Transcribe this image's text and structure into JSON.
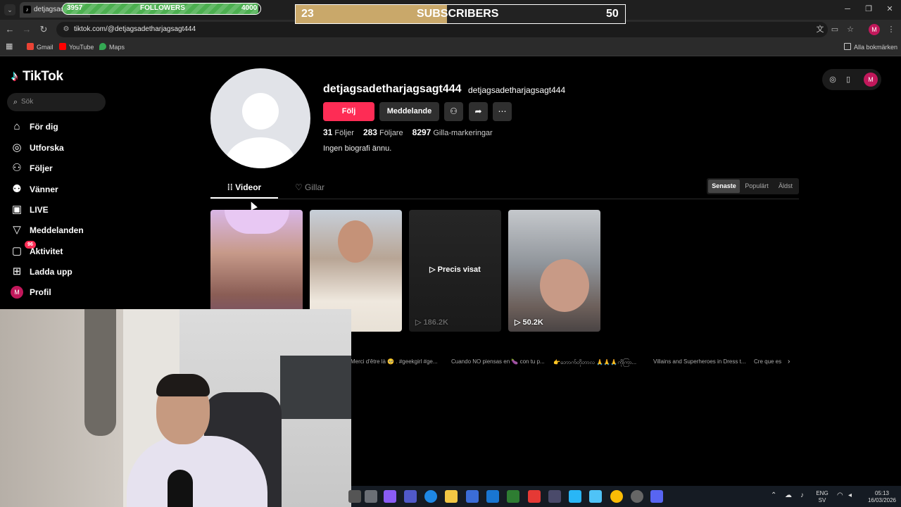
{
  "browser": {
    "tab_title": "detjagsadet",
    "url": "tiktok.com/@detjagsadetharjagsagt444",
    "bookmarks": [
      "Gmail",
      "YouTube",
      "Maps"
    ],
    "all_bookmarks": "Alla bokmärken",
    "profile_initial": "M"
  },
  "overlays": {
    "followers": {
      "label": "FOLLOWERS",
      "current": "3957",
      "goal": "4000",
      "progress": 0.99
    },
    "subscribers": {
      "label": "SUBSCRIBERS",
      "current": "23",
      "goal": "50",
      "progress": 0.46
    }
  },
  "sidebar": {
    "logo": "TikTok",
    "search_placeholder": "Sök",
    "items": [
      {
        "label": "För dig",
        "icon": "home-icon"
      },
      {
        "label": "Utforska",
        "icon": "compass-icon"
      },
      {
        "label": "Följer",
        "icon": "following-icon"
      },
      {
        "label": "Vänner",
        "icon": "friends-icon"
      },
      {
        "label": "LIVE",
        "icon": "live-icon"
      },
      {
        "label": "Meddelanden",
        "icon": "messages-icon"
      },
      {
        "label": "Aktivitet",
        "icon": "activity-icon",
        "badge": "96"
      },
      {
        "label": "Ladda upp",
        "icon": "upload-icon"
      },
      {
        "label": "Profil",
        "icon": "profile-icon",
        "initial": "M"
      }
    ]
  },
  "profile": {
    "username": "detjagsadetharjagsagt444",
    "nickname": "detjagsadetharjagsagt444",
    "follow_label": "Följ",
    "message_label": "Meddelande",
    "following_count": "31",
    "following_label": "Följer",
    "followers_count": "283",
    "followers_label": "Följare",
    "likes_count": "8297",
    "likes_label": "Gilla-markeringar",
    "bio": "Ingen biografi ännu."
  },
  "tabs": {
    "videos": "Videor",
    "likes": "Gillar"
  },
  "sort": {
    "latest": "Senaste",
    "popular": "Populärt",
    "oldest": "Äldst",
    "active": "latest"
  },
  "videos": [
    {
      "views": ""
    },
    {
      "views": ""
    },
    {
      "views": "186.2K",
      "overlay": "Precis visat"
    },
    {
      "views": "50.2K"
    }
  ],
  "related": [
    "Merci d'être là 🥺 . #geekgirl #ge...",
    "Cuando NO piensas en 🍆 con tu p...",
    "👉ဘောက်တိုဘာလ 🙏🙏🙏ကိုကြာ...",
    "Villains and Superheroes in Dress t...",
    "Cre que es"
  ],
  "system": {
    "lang": "ENG",
    "lang2": "SV",
    "time": "05:13",
    "date": "16/03/2026"
  },
  "colors": {
    "accent": "#fe2c55",
    "background": "#000000",
    "followers_fill": "#4caf50",
    "subs_fill": "#c9a86a"
  }
}
